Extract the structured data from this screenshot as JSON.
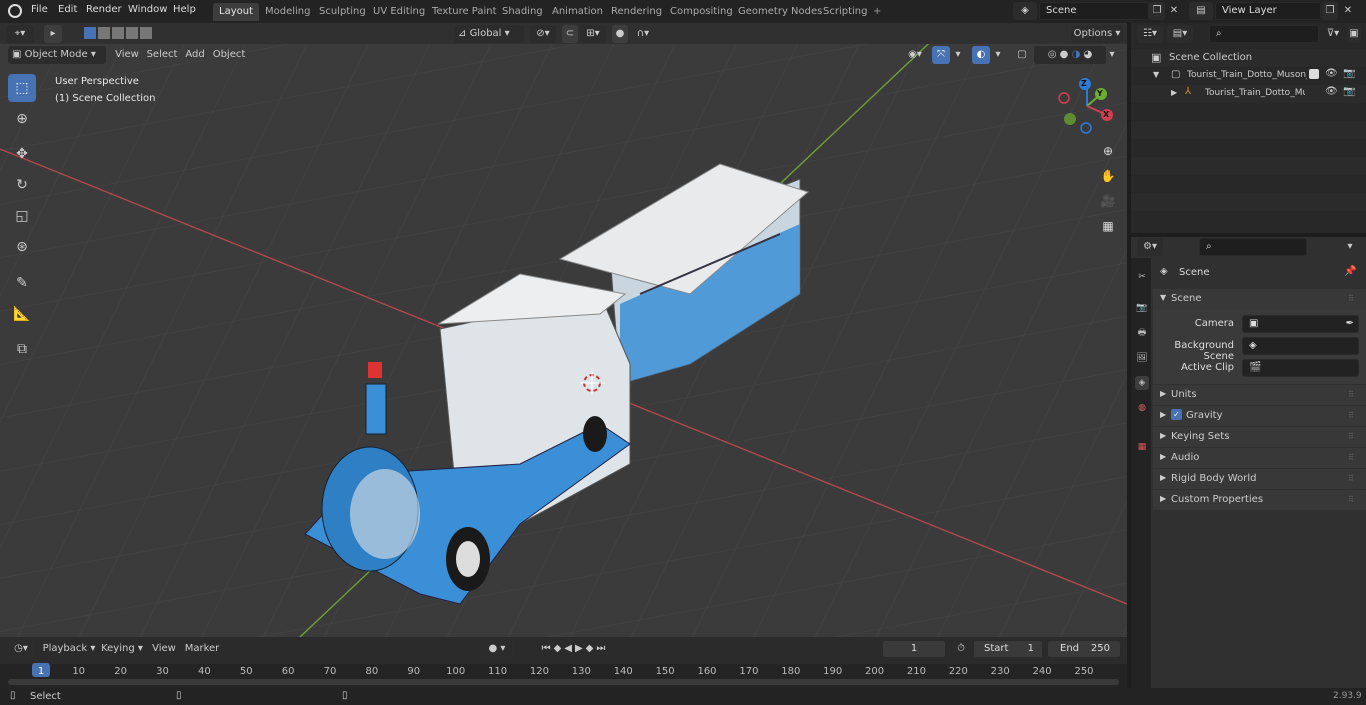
{
  "topbar": {
    "menus": [
      "File",
      "Edit",
      "Render",
      "Window",
      "Help"
    ],
    "workspaces": [
      "Layout",
      "Modeling",
      "Sculpting",
      "UV Editing",
      "Texture Paint",
      "Shading",
      "Animation",
      "Rendering",
      "Compositing",
      "Geometry Nodes",
      "Scripting"
    ],
    "active_workspace": "Layout",
    "add_tab": "+",
    "scene_name": "Scene",
    "view_layer": "View Layer"
  },
  "viewport_header": {
    "mode": "Object Mode",
    "menus": [
      "View",
      "Select",
      "Add",
      "Object"
    ],
    "transform_orientation": "Global",
    "options": "Options"
  },
  "viewport": {
    "perspective": "User Perspective",
    "collection": "(1) Scene Collection",
    "gizmo": {
      "x": "X",
      "y": "Y",
      "z": "Z"
    }
  },
  "outliner": {
    "root": "Scene Collection",
    "items": [
      {
        "label": "Tourist_Train_Dotto_Muson_R"
      },
      {
        "label": "Tourist_Train_Dotto_Musc"
      }
    ]
  },
  "properties": {
    "context": "Scene",
    "panel_title": "Scene",
    "fields": [
      {
        "label": "Camera"
      },
      {
        "label": "Background Scene"
      },
      {
        "label": "Active Clip"
      }
    ],
    "sections": [
      "Units",
      "Gravity",
      "Keying Sets",
      "Audio",
      "Rigid Body World",
      "Custom Properties"
    ]
  },
  "timeline": {
    "menus": [
      "Playback",
      "Keying",
      "View",
      "Marker"
    ],
    "current_frame": "1",
    "start_label": "Start",
    "start": "1",
    "end_label": "End",
    "end": "250",
    "ticks": [
      "1",
      "10",
      "20",
      "30",
      "40",
      "50",
      "60",
      "70",
      "80",
      "90",
      "100",
      "110",
      "120",
      "130",
      "140",
      "150",
      "160",
      "170",
      "180",
      "190",
      "200",
      "210",
      "220",
      "230",
      "240",
      "250"
    ]
  },
  "status": {
    "left": "Select",
    "version": "2.93.9"
  },
  "colors": {
    "accent": "#4772b3",
    "viewport_bg": "#3b3b3b",
    "train_blue": "#3a8fd6"
  }
}
